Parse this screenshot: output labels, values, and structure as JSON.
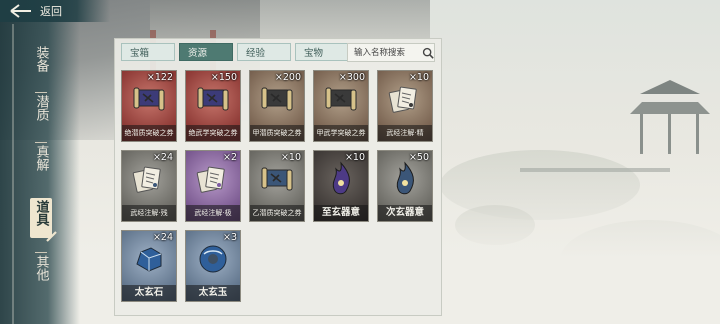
{
  "nav": {
    "back_label": "返回",
    "items": [
      {
        "label": "装备",
        "active": false
      },
      {
        "label": "潜质",
        "active": false
      },
      {
        "label": "真解",
        "active": false
      },
      {
        "label": "道具",
        "active": true
      },
      {
        "label": "其他",
        "active": false
      }
    ]
  },
  "tabs": [
    {
      "label": "宝箱",
      "active": false
    },
    {
      "label": "资源",
      "active": true
    },
    {
      "label": "经验",
      "active": false
    },
    {
      "label": "宝物",
      "active": false
    }
  ],
  "search": {
    "placeholder": "输入名称搜索"
  },
  "items": [
    {
      "name": "绝潜质突破之券",
      "qty": "×122",
      "rarity": "red",
      "icon": "scroll-icon"
    },
    {
      "name": "绝武学突破之券",
      "qty": "×150",
      "rarity": "red",
      "icon": "scroll-icon"
    },
    {
      "name": "甲潜质突破之券",
      "qty": "×200",
      "rarity": "bronze",
      "icon": "scroll-icon"
    },
    {
      "name": "甲武学突破之券",
      "qty": "×300",
      "rarity": "bronze",
      "icon": "scroll-icon"
    },
    {
      "name": "武经注解·精",
      "qty": "×10",
      "rarity": "bronze",
      "icon": "cards-icon"
    },
    {
      "name": "武经注解·残",
      "qty": "×24",
      "rarity": "gray",
      "icon": "cards-icon"
    },
    {
      "name": "武经注解·极",
      "qty": "×2",
      "rarity": "purple",
      "icon": "cards-icon"
    },
    {
      "name": "乙潜质突破之券",
      "qty": "×10",
      "rarity": "gray",
      "icon": "scroll-icon"
    },
    {
      "name": "至玄器意",
      "qty": "×10",
      "rarity": "dark",
      "icon": "flame-icon"
    },
    {
      "name": "次玄器意",
      "qty": "×50",
      "rarity": "gray",
      "icon": "flame-icon"
    },
    {
      "name": "太玄石",
      "qty": "×24",
      "rarity": "blue",
      "icon": "stone-icon"
    },
    {
      "name": "太玄玉",
      "qty": "×3",
      "rarity": "blue",
      "icon": "jade-icon"
    }
  ],
  "colors": {
    "accent": "#4e7a72",
    "nav_bg": "#1f3e44",
    "active_nav": "#efe6cf"
  }
}
